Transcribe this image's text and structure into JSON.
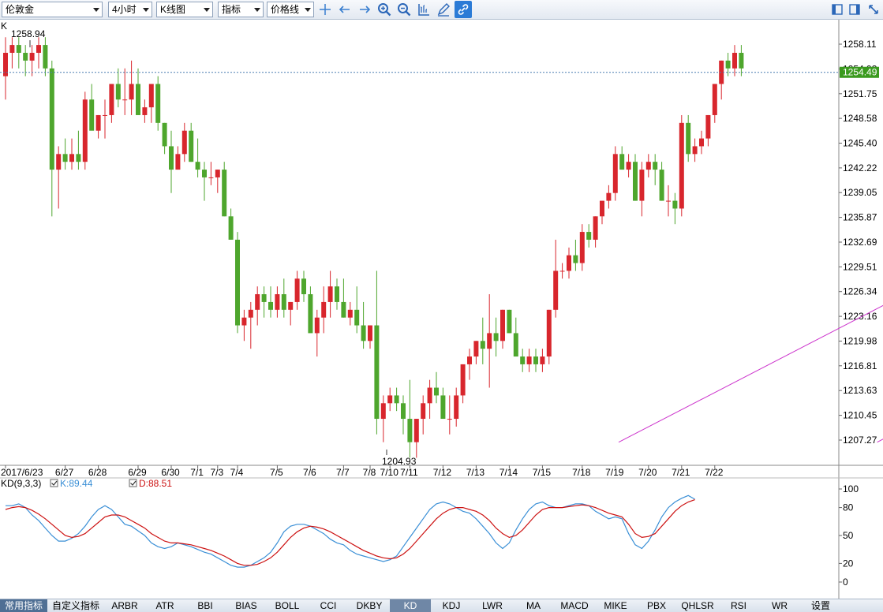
{
  "toolbar": {
    "symbol": "伦敦金",
    "period": "4小时",
    "chart_type": "K线图",
    "indicator": "指标",
    "price_line": "价格线"
  },
  "chart_data": {
    "type": "candlestick",
    "corner_label": "K",
    "high_label": "1258.94",
    "low_label": "1204.93",
    "last_price": "1254.49",
    "y_ticks": [
      "1258.11",
      "1254.93",
      "1251.75",
      "1248.58",
      "1245.40",
      "1242.22",
      "1239.05",
      "1235.87",
      "1232.69",
      "1229.51",
      "1226.34",
      "1223.16",
      "1219.98",
      "1216.81",
      "1213.63",
      "1210.45",
      "1207.27"
    ],
    "y_tick_values": [
      1258.11,
      1254.93,
      1251.75,
      1248.58,
      1245.4,
      1242.22,
      1239.05,
      1235.87,
      1232.69,
      1229.51,
      1226.34,
      1223.16,
      1219.98,
      1216.81,
      1213.63,
      1210.45,
      1207.27
    ],
    "x_labels": [
      "2017/6/23",
      "6/27",
      "6/28",
      "6/29",
      "6/30",
      "7/1",
      "7/3",
      "7/4",
      "7/5",
      "7/6",
      "7/7",
      "7/8",
      "7/10",
      "7/11",
      "7/12",
      "7/13",
      "7/14",
      "7/15",
      "7/18",
      "7/19",
      "7/20",
      "7/21",
      "7/22"
    ],
    "x_label_index": [
      0,
      9,
      14,
      20,
      25,
      29,
      32,
      35,
      41,
      46,
      51,
      55,
      58,
      61,
      66,
      71,
      76,
      81,
      87,
      92,
      97,
      102,
      107
    ],
    "colors": {
      "up": "#d8262d",
      "down": "#4ea62d",
      "channel": "#cc33cc",
      "k_line": "#3a8fd6",
      "d_line": "#cc1111",
      "price_line": "#4a7fb0",
      "last_price_box": "#3a9a1e"
    },
    "candles": [
      [
        1254,
        1259,
        1251,
        1257
      ],
      [
        1257,
        1259,
        1255,
        1258
      ],
      [
        1258,
        1259,
        1255,
        1257
      ],
      [
        1257,
        1258,
        1254,
        1256
      ],
      [
        1256,
        1258,
        1254,
        1257
      ],
      [
        1257,
        1259,
        1255,
        1258
      ],
      [
        1258,
        1259,
        1254,
        1255
      ],
      [
        1255,
        1256,
        1236,
        1242
      ],
      [
        1242,
        1245,
        1237,
        1244
      ],
      [
        1244,
        1246,
        1242,
        1243
      ],
      [
        1243,
        1246,
        1242,
        1244
      ],
      [
        1244,
        1247,
        1242,
        1243
      ],
      [
        1243,
        1252,
        1242,
        1251
      ],
      [
        1251,
        1253,
        1249,
        1247
      ],
      [
        1247,
        1249,
        1246,
        1249
      ],
      [
        1249,
        1251,
        1246,
        1249
      ],
      [
        1249,
        1252,
        1248,
        1253
      ],
      [
        1253,
        1255,
        1250,
        1251
      ],
      [
        1251,
        1255,
        1249,
        1251
      ],
      [
        1251,
        1256,
        1249,
        1253
      ],
      [
        1253,
        1255,
        1249,
        1249
      ],
      [
        1249,
        1251,
        1248,
        1250
      ],
      [
        1250,
        1251,
        1248,
        1253
      ],
      [
        1253,
        1254,
        1247,
        1248
      ],
      [
        1248,
        1248,
        1244,
        1245
      ],
      [
        1245,
        1247,
        1239,
        1242
      ],
      [
        1242,
        1245,
        1242,
        1244
      ],
      [
        1244,
        1248,
        1243,
        1247
      ],
      [
        1247,
        1248,
        1243,
        1243
      ],
      [
        1243,
        1246,
        1241,
        1242
      ],
      [
        1242,
        1243,
        1238,
        1241
      ],
      [
        1241,
        1243,
        1240,
        1241
      ],
      [
        1241,
        1242,
        1239,
        1242
      ],
      [
        1242,
        1243,
        1236,
        1236
      ],
      [
        1236,
        1237,
        1233,
        1233
      ],
      [
        1233,
        1234,
        1221,
        1222
      ],
      [
        1222,
        1224,
        1220,
        1223
      ],
      [
        1223,
        1225,
        1219,
        1224
      ],
      [
        1224,
        1227,
        1222,
        1226
      ],
      [
        1226,
        1227,
        1223,
        1225
      ],
      [
        1225,
        1227,
        1223,
        1224
      ],
      [
        1224,
        1227,
        1223,
        1226
      ],
      [
        1226,
        1228,
        1223,
        1224
      ],
      [
        1224,
        1225,
        1222,
        1225
      ],
      [
        1225,
        1229,
        1224,
        1228
      ],
      [
        1228,
        1229,
        1225,
        1226
      ],
      [
        1226,
        1227,
        1222,
        1221
      ],
      [
        1221,
        1224,
        1218,
        1223
      ],
      [
        1223,
        1227,
        1221,
        1225
      ],
      [
        1225,
        1229,
        1223,
        1227
      ],
      [
        1227,
        1228,
        1224,
        1225
      ],
      [
        1225,
        1228,
        1223,
        1223
      ],
      [
        1223,
        1225,
        1222,
        1224
      ],
      [
        1224,
        1227,
        1221,
        1222
      ],
      [
        1222,
        1225,
        1219,
        1220
      ],
      [
        1220,
        1222,
        1219,
        1222
      ],
      [
        1222,
        1229,
        1208,
        1210
      ],
      [
        1210,
        1213,
        1207,
        1212
      ],
      [
        1212,
        1214,
        1211,
        1213
      ],
      [
        1213,
        1214,
        1211,
        1212
      ],
      [
        1212,
        1213,
        1208,
        1210
      ],
      [
        1210,
        1215,
        1205,
        1207
      ],
      [
        1207,
        1210,
        1205,
        1210
      ],
      [
        1210,
        1213,
        1208,
        1212
      ],
      [
        1212,
        1215,
        1210,
        1214
      ],
      [
        1214,
        1216,
        1212,
        1213
      ],
      [
        1213,
        1214,
        1210,
        1210
      ],
      [
        1210,
        1213,
        1208,
        1210
      ],
      [
        1210,
        1214,
        1209,
        1213
      ],
      [
        1213,
        1217,
        1212,
        1217
      ],
      [
        1217,
        1219,
        1215,
        1218
      ],
      [
        1218,
        1220,
        1217,
        1220
      ],
      [
        1220,
        1223,
        1217,
        1219
      ],
      [
        1219,
        1226,
        1214,
        1221
      ],
      [
        1221,
        1223,
        1218,
        1220
      ],
      [
        1220,
        1224,
        1219,
        1224
      ],
      [
        1224,
        1224,
        1221,
        1221
      ],
      [
        1221,
        1223,
        1219,
        1218
      ],
      [
        1218,
        1219,
        1216,
        1217
      ],
      [
        1217,
        1219,
        1216,
        1218
      ],
      [
        1218,
        1219,
        1216,
        1217
      ],
      [
        1217,
        1219,
        1216,
        1218
      ],
      [
        1218,
        1224,
        1217,
        1224
      ],
      [
        1224,
        1233,
        1223,
        1229
      ],
      [
        1229,
        1230,
        1228,
        1229
      ],
      [
        1229,
        1232,
        1228,
        1231
      ],
      [
        1231,
        1233,
        1229,
        1230
      ],
      [
        1230,
        1235,
        1229,
        1234
      ],
      [
        1234,
        1235,
        1232,
        1233
      ],
      [
        1233,
        1236,
        1232,
        1236
      ],
      [
        1236,
        1238,
        1235,
        1238
      ],
      [
        1238,
        1240,
        1237,
        1239
      ],
      [
        1239,
        1245,
        1238,
        1244
      ],
      [
        1244,
        1245,
        1242,
        1242
      ],
      [
        1242,
        1244,
        1241,
        1243
      ],
      [
        1243,
        1244,
        1238,
        1238
      ],
      [
        1238,
        1243,
        1236,
        1242
      ],
      [
        1242,
        1244,
        1241,
        1243
      ],
      [
        1243,
        1244,
        1240,
        1242
      ],
      [
        1242,
        1243,
        1238,
        1238
      ],
      [
        1238,
        1240,
        1236,
        1238
      ],
      [
        1238,
        1239,
        1235,
        1237
      ],
      [
        1237,
        1249,
        1236,
        1248
      ],
      [
        1248,
        1249,
        1243,
        1244
      ],
      [
        1244,
        1246,
        1243,
        1245
      ],
      [
        1245,
        1247,
        1244,
        1246
      ],
      [
        1246,
        1249,
        1245,
        1249
      ],
      [
        1249,
        1253,
        1248,
        1253
      ],
      [
        1253,
        1256,
        1251,
        1256
      ],
      [
        1256,
        1257,
        1254,
        1255
      ],
      [
        1255,
        1258,
        1254,
        1257
      ],
      [
        1257,
        1258,
        1254,
        1255
      ]
    ],
    "channel": {
      "upper": [
        [
          92.5,
          1207.0
        ],
        [
          213,
          1260.0
        ]
      ],
      "lower": [
        [
          131.5,
          1207.0
        ],
        [
          250,
          1260.0
        ]
      ]
    },
    "kd": {
      "label": "KD(9,3,3)",
      "k_label": "K:89.44",
      "d_label": "D:88.51",
      "y_ticks": [
        "100",
        "80",
        "50",
        "20",
        "0"
      ],
      "y_tick_values": [
        100,
        80,
        50,
        20,
        0
      ],
      "k": [
        82,
        82,
        84,
        80,
        72,
        66,
        58,
        50,
        44,
        44,
        47,
        52,
        60,
        70,
        78,
        82,
        78,
        70,
        62,
        60,
        55,
        50,
        42,
        38,
        36,
        38,
        42,
        40,
        38,
        35,
        32,
        30,
        26,
        22,
        18,
        16,
        16,
        18,
        22,
        26,
        32,
        42,
        54,
        60,
        62,
        62,
        60,
        56,
        52,
        46,
        42,
        40,
        34,
        30,
        28,
        26,
        24,
        22,
        24,
        28,
        38,
        48,
        58,
        68,
        78,
        84,
        86,
        84,
        80,
        76,
        74,
        68,
        60,
        52,
        42,
        36,
        42,
        56,
        68,
        78,
        84,
        86,
        82,
        80,
        80,
        82,
        84,
        84,
        82,
        76,
        72,
        68,
        70,
        68,
        52,
        40,
        36,
        44,
        56,
        70,
        80,
        86,
        90,
        93,
        89
      ],
      "d": [
        78,
        80,
        81,
        80,
        77,
        73,
        68,
        62,
        56,
        50,
        48,
        49,
        52,
        58,
        64,
        70,
        72,
        72,
        70,
        66,
        62,
        58,
        52,
        48,
        44,
        42,
        42,
        41,
        40,
        38,
        36,
        34,
        31,
        28,
        24,
        20,
        18,
        18,
        19,
        22,
        26,
        32,
        40,
        48,
        54,
        58,
        60,
        59,
        57,
        54,
        50,
        46,
        42,
        38,
        34,
        31,
        28,
        26,
        25,
        26,
        30,
        36,
        44,
        52,
        60,
        68,
        74,
        78,
        80,
        80,
        78,
        76,
        72,
        66,
        58,
        52,
        48,
        50,
        56,
        64,
        72,
        78,
        80,
        80,
        80,
        81,
        82,
        83,
        82,
        80,
        77,
        74,
        72,
        70,
        62,
        52,
        48,
        49,
        52,
        60,
        68,
        76,
        82,
        86,
        88.5
      ]
    }
  },
  "tabs": [
    "常用指标",
    "自定义指标",
    "ARBR",
    "ATR",
    "BBI",
    "BIAS",
    "BOLL",
    "CCI",
    "DKBY",
    "KD",
    "KDJ",
    "LWR",
    "MA",
    "MACD",
    "MIKE",
    "PBX",
    "QHLSR",
    "RSI",
    "WR",
    "设置"
  ],
  "active_tab": "KD"
}
